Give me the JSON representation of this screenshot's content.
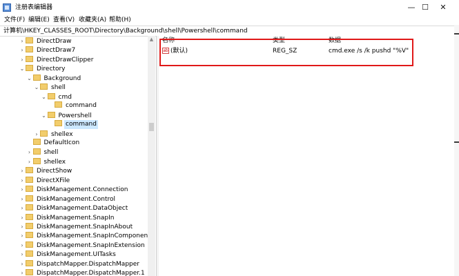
{
  "window": {
    "title": "注册表编辑器",
    "minimize_glyph": "—",
    "maximize_glyph": "☐",
    "close_glyph": "✕"
  },
  "menu": [
    "文件(F)",
    "编辑(E)",
    "查看(V)",
    "收藏夹(A)",
    "帮助(H)"
  ],
  "address": "计算机\\HKEY_CLASSES_ROOT\\Directory\\Background\\shell\\Powershell\\command",
  "tree": [
    {
      "label": "DirectDraw",
      "arrow": "›",
      "depth": 0
    },
    {
      "label": "DirectDraw7",
      "arrow": "›",
      "depth": 0
    },
    {
      "label": "DirectDrawClipper",
      "arrow": "›",
      "depth": 0
    },
    {
      "label": "Directory",
      "arrow": "⌄",
      "depth": 0
    },
    {
      "label": "Background",
      "arrow": "⌄",
      "depth": 1
    },
    {
      "label": "shell",
      "arrow": "⌄",
      "depth": 2
    },
    {
      "label": "cmd",
      "arrow": "⌄",
      "depth": 3
    },
    {
      "label": "command",
      "arrow": "",
      "depth": 4
    },
    {
      "label": "Powershell",
      "arrow": "⌄",
      "depth": 3
    },
    {
      "label": "command",
      "arrow": "",
      "depth": 4,
      "selected": true
    },
    {
      "label": "shellex",
      "arrow": "›",
      "depth": 2
    },
    {
      "label": "DefaultIcon",
      "arrow": "",
      "depth": 1
    },
    {
      "label": "shell",
      "arrow": "›",
      "depth": 1
    },
    {
      "label": "shellex",
      "arrow": "›",
      "depth": 1
    },
    {
      "label": "DirectShow",
      "arrow": "›",
      "depth": 0
    },
    {
      "label": "DirectXFile",
      "arrow": "›",
      "depth": 0
    },
    {
      "label": "DiskManagement.Connection",
      "arrow": "›",
      "depth": 0
    },
    {
      "label": "DiskManagement.Control",
      "arrow": "›",
      "depth": 0
    },
    {
      "label": "DiskManagement.DataObject",
      "arrow": "›",
      "depth": 0
    },
    {
      "label": "DiskManagement.SnapIn",
      "arrow": "›",
      "depth": 0
    },
    {
      "label": "DiskManagement.SnapInAbout",
      "arrow": "›",
      "depth": 0
    },
    {
      "label": "DiskManagement.SnapInComponent",
      "arrow": "›",
      "depth": 0
    },
    {
      "label": "DiskManagement.SnapInExtension",
      "arrow": "›",
      "depth": 0
    },
    {
      "label": "DiskManagement.UITasks",
      "arrow": "›",
      "depth": 0
    },
    {
      "label": "DispatchMapper.DispatchMapper",
      "arrow": "›",
      "depth": 0
    },
    {
      "label": "DispatchMapper.DispatchMapper.1",
      "arrow": "›",
      "depth": 0
    }
  ],
  "values": {
    "columns": {
      "name": "名称",
      "type": "类型",
      "data": "数据"
    },
    "rows": [
      {
        "icon": "ab",
        "name": "(默认)",
        "type": "REG_SZ",
        "data": "cmd.exe /s /k pushd \"%V\""
      }
    ]
  },
  "colors": {
    "highlight_border": "#e01818",
    "selection": "#cce8ff",
    "folder": "#f2cd6c"
  }
}
